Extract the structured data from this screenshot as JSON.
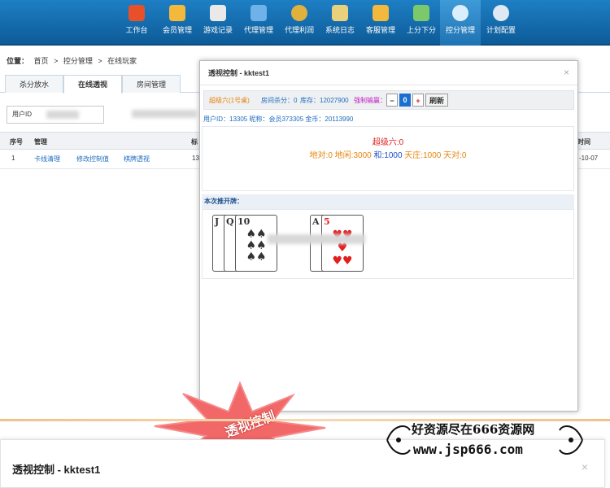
{
  "nav": {
    "items": [
      {
        "label": "工作台",
        "icon": "house-icon",
        "color": "#e8502a"
      },
      {
        "label": "会员管理",
        "icon": "users-icon",
        "color": "#f2b93c"
      },
      {
        "label": "游戏记录",
        "icon": "pen-icon",
        "color": "#e9e9e9"
      },
      {
        "label": "代理管理",
        "icon": "monitor-icon",
        "color": "#6fb2ea"
      },
      {
        "label": "代理利润",
        "icon": "money-bag-icon",
        "color": "#e2b13c"
      },
      {
        "label": "系统日志",
        "icon": "clipboard-icon",
        "color": "#e9d07a"
      },
      {
        "label": "客服管理",
        "icon": "people-icon",
        "color": "#f2b93c"
      },
      {
        "label": "上分下分",
        "icon": "chart-icon",
        "color": "#7cc96c"
      },
      {
        "label": "控分管理",
        "icon": "control-icon",
        "color": "#dbeefc",
        "active": true
      },
      {
        "label": "计划配置",
        "icon": "gears-icon",
        "color": "#dfe9f3"
      }
    ]
  },
  "breadcrumb": {
    "prefix": "位置：",
    "items": [
      "首页",
      "控分管理",
      "在线玩家"
    ],
    "sep": ">"
  },
  "tabs": [
    "杀分放水",
    "在线透视",
    "房间管理"
  ],
  "filter": {
    "user_id_label": "用户ID"
  },
  "table": {
    "headers": [
      "序号",
      "管理",
      "标"
    ],
    "rows": [
      {
        "index": "1",
        "action1": "卡线清理",
        "action2": "修改控制值",
        "action3": "棋牌透视",
        "col4": "13",
        "date_frag": "-10-07"
      }
    ],
    "right_header_frag": "时间"
  },
  "modal": {
    "title": "透视控制 - kktest1",
    "close": "×",
    "ctrl": {
      "game": "超级六(1号桌)",
      "room_score": "房间杀分：0",
      "stock": "库存：12027900",
      "strong_label": "强制输赢：",
      "minus": "−",
      "value": "0",
      "plus": "+",
      "refresh": "刷新"
    },
    "info": "用户ID：13305  昵称：会员373305  金币：20113990",
    "result_line1": "超级六:0",
    "result_line2a": "地对:0 地闲:3000",
    "result_line2b": "和:1000",
    "result_line2c": "天庄:1000 天对:0",
    "cards_title": "本次推开牌：",
    "cards_left": [
      "J",
      "Q",
      "10"
    ],
    "cards_right": [
      "A",
      "5"
    ]
  },
  "stamp": "透视控制",
  "bottom": {
    "title": "透视控制 - kktest1",
    "close": "×"
  },
  "watermark": {
    "line1": "好资源尽在666资源网",
    "line2": "www.jsp666.com"
  }
}
